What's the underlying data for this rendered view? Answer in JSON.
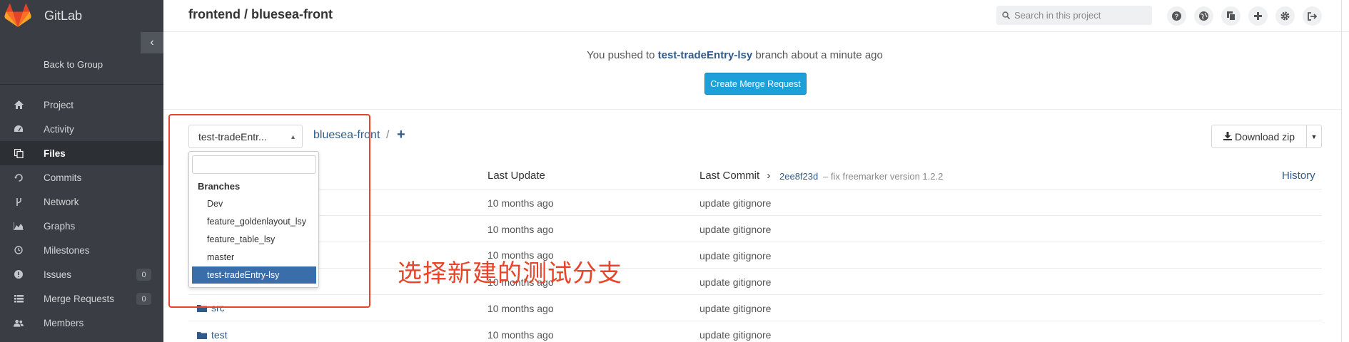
{
  "app": {
    "name": "GitLab",
    "brand_color": "#e24329"
  },
  "sidebar": {
    "back_label": "Back to Group",
    "collapse_icon": "chevron-left-icon",
    "items": [
      {
        "label": "Project",
        "icon": "home-icon",
        "active": false
      },
      {
        "label": "Activity",
        "icon": "dashboard-icon",
        "active": false
      },
      {
        "label": "Files",
        "icon": "files-icon",
        "active": true
      },
      {
        "label": "Commits",
        "icon": "history-icon",
        "active": false
      },
      {
        "label": "Network",
        "icon": "fork-icon",
        "active": false
      },
      {
        "label": "Graphs",
        "icon": "area-chart-icon",
        "active": false
      },
      {
        "label": "Milestones",
        "icon": "clock-icon",
        "active": false
      },
      {
        "label": "Issues",
        "icon": "exclamation-circle-icon",
        "active": false,
        "badge": "0"
      },
      {
        "label": "Merge Requests",
        "icon": "list-icon",
        "active": false,
        "badge": "0"
      },
      {
        "label": "Members",
        "icon": "users-icon",
        "active": false
      }
    ]
  },
  "header": {
    "title": "frontend / bluesea-front",
    "search_placeholder": "Search in this project"
  },
  "notice": {
    "prefix": "You pushed to ",
    "branch": "test-tradeEntry-lsy",
    "suffix": " branch about a minute ago",
    "button": "Create Merge Request"
  },
  "toolbar": {
    "branch_selected": "test-tradeEntr...",
    "repo_link": "bluesea-front",
    "separator": "/",
    "add": "+",
    "download": "Download zip"
  },
  "table": {
    "col_update": "Last Update",
    "col_commit": "Last Commit",
    "commit_arrow": "›",
    "commit_hash": "2ee8f23d",
    "commit_msg": "– fix freemarker version 1.2.2",
    "history": "History",
    "rows": [
      {
        "name": "",
        "updated": "10 months ago",
        "commit": "update gitignore"
      },
      {
        "name": "",
        "updated": "10 months ago",
        "commit": "update gitignore"
      },
      {
        "name": "",
        "updated": "10 months ago",
        "commit": "update gitignore"
      },
      {
        "name": "",
        "updated": "10 months ago",
        "commit": "update gitignore"
      },
      {
        "name": "src",
        "updated": "10 months ago",
        "commit": "update gitignore"
      },
      {
        "name": "test",
        "updated": "10 months ago",
        "commit": "update gitignore"
      }
    ]
  },
  "dropdown": {
    "header": "Branches",
    "branches": [
      "Dev",
      "feature_goldenlayout_lsy",
      "feature_table_lsy",
      "master",
      "test-tradeEntry-lsy"
    ],
    "selected_index": 4
  },
  "annotation": {
    "text": "选择新建的测试分支",
    "color": "#e8442a"
  }
}
